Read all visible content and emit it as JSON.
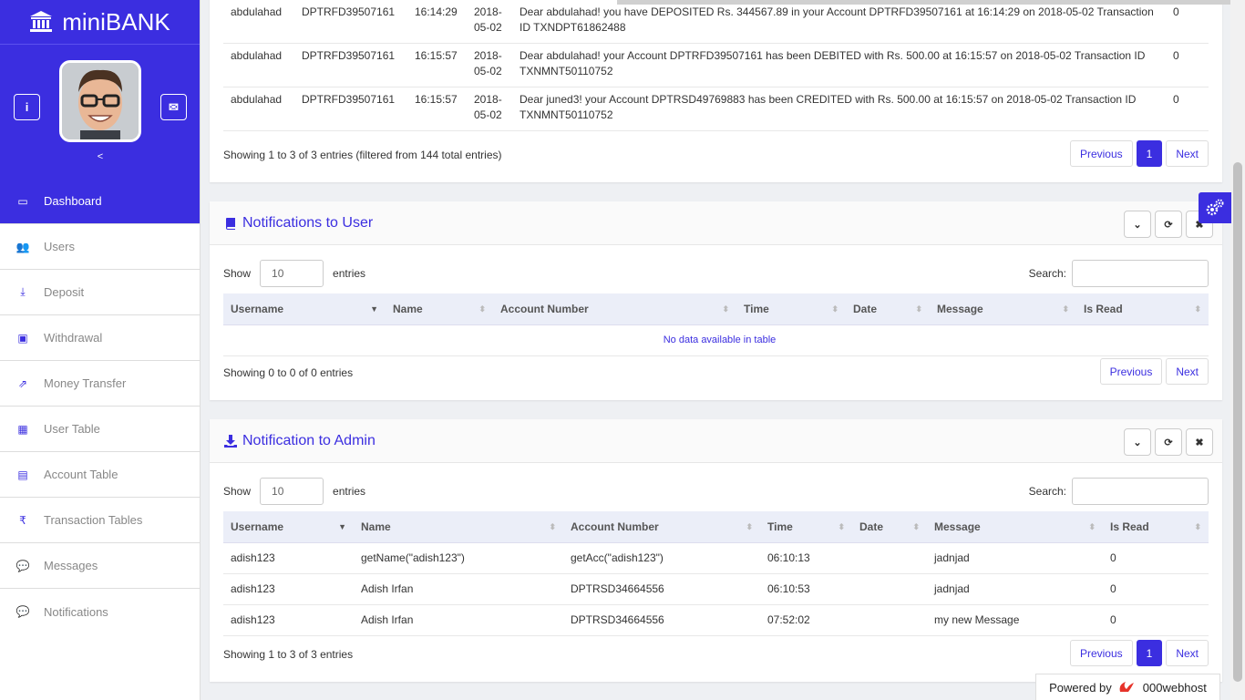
{
  "app": {
    "name": "miniBANK",
    "collapse_label": "<"
  },
  "colors": {
    "accent": "#3b2ee0"
  },
  "sidebar": {
    "items": [
      {
        "label": "Dashboard",
        "icon": "desktop-icon",
        "glyph": "▭",
        "active": true
      },
      {
        "label": "Users",
        "icon": "users-icon",
        "glyph": "👥",
        "active": false
      },
      {
        "label": "Deposit",
        "icon": "download-icon",
        "glyph": "⤓",
        "active": false
      },
      {
        "label": "Withdrawal",
        "icon": "briefcase-icon",
        "glyph": "▣",
        "active": false
      },
      {
        "label": "Money Transfer",
        "icon": "share-icon",
        "glyph": "⇗",
        "active": false
      },
      {
        "label": "User Table",
        "icon": "table-icon",
        "glyph": "▦",
        "active": false
      },
      {
        "label": "Account Table",
        "icon": "building-icon",
        "glyph": "▤",
        "active": false
      },
      {
        "label": "Transaction Tables",
        "icon": "rupee-icon",
        "glyph": "₹",
        "active": false
      },
      {
        "label": "Messages",
        "icon": "comments-icon",
        "glyph": "💬",
        "active": false
      },
      {
        "label": "Notifications",
        "icon": "comments-icon",
        "glyph": "💬",
        "active": false
      }
    ]
  },
  "top_table": {
    "rows": [
      {
        "username": "abdulahad",
        "account": "DPTRFD39507161",
        "time": "16:14:29",
        "date": "2018-05-02",
        "message": "Dear abdulahad! you have DEPOSITED Rs. 344567.89 in your Account DPTRFD39507161 at 16:14:29 on 2018-05-02 Transaction ID TXNDPT61862488",
        "is_read": "0"
      },
      {
        "username": "abdulahad",
        "account": "DPTRFD39507161",
        "time": "16:15:57",
        "date": "2018-05-02",
        "message": "Dear abdulahad! your Account DPTRFD39507161 has been DEBITED with Rs. 500.00 at 16:15:57 on 2018-05-02 Transaction ID TXNMNT50110752",
        "is_read": "0"
      },
      {
        "username": "abdulahad",
        "account": "DPTRFD39507161",
        "time": "16:15:57",
        "date": "2018-05-02",
        "message": "Dear juned3! your Account DPTRSD49769883 has been CREDITED with Rs. 500.00 at 16:15:57 on 2018-05-02 Transaction ID TXNMNT50110752",
        "is_read": "0"
      }
    ],
    "info": "Showing 1 to 3 of 3 entries (filtered from 144 total entries)",
    "prev": "Previous",
    "page": "1",
    "next": "Next"
  },
  "user_panel": {
    "title": "Notifications to User",
    "show_label": "Show",
    "entries_label": "entries",
    "page_length": "10",
    "search_label": "Search:",
    "columns": [
      "Username",
      "Name",
      "Account Number",
      "Time",
      "Date",
      "Message",
      "Is Read"
    ],
    "empty": "No data available in table",
    "info": "Showing 0 to 0 of 0 entries",
    "prev": "Previous",
    "next": "Next"
  },
  "admin_panel": {
    "title": "Notification to Admin",
    "show_label": "Show",
    "entries_label": "entries",
    "page_length": "10",
    "search_label": "Search:",
    "columns": [
      "Username",
      "Name",
      "Account Number",
      "Time",
      "Date",
      "Message",
      "Is Read"
    ],
    "rows": [
      {
        "username": "adish123",
        "name": "getName(\"adish123\")",
        "account": "getAcc(\"adish123\")",
        "time": "06:10:13",
        "date": "",
        "message": "jadnjad",
        "is_read": "0"
      },
      {
        "username": "adish123",
        "name": "Adish Irfan",
        "account": "DPTRSD34664556",
        "time": "06:10:53",
        "date": "",
        "message": "jadnjad",
        "is_read": "0"
      },
      {
        "username": "adish123",
        "name": "Adish Irfan",
        "account": "DPTRSD34664556",
        "time": "07:52:02",
        "date": "",
        "message": "my new Message",
        "is_read": "0"
      }
    ],
    "info": "Showing 1 to 3 of 3 entries",
    "prev": "Previous",
    "page": "1",
    "next": "Next"
  },
  "footer": {
    "powered_by": "Powered by",
    "host": "000webhost"
  }
}
